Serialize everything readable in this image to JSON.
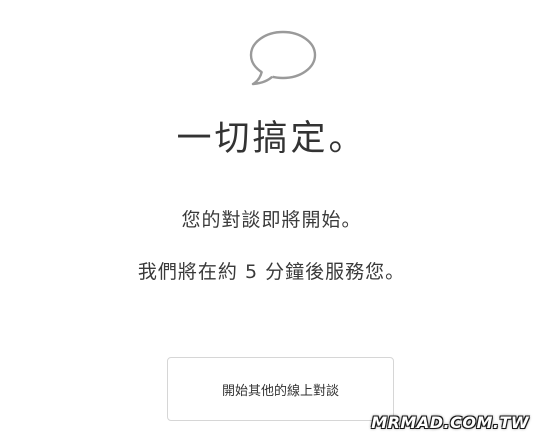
{
  "icon": "speech-bubble-icon",
  "title": "一切搞定。",
  "message": {
    "line1": "您的對談即將開始。",
    "line2": "我們將在約 5 分鐘後服務您。"
  },
  "button": {
    "label": "開始其他的線上對談"
  },
  "watermark": "MRMAD.COM.TW"
}
